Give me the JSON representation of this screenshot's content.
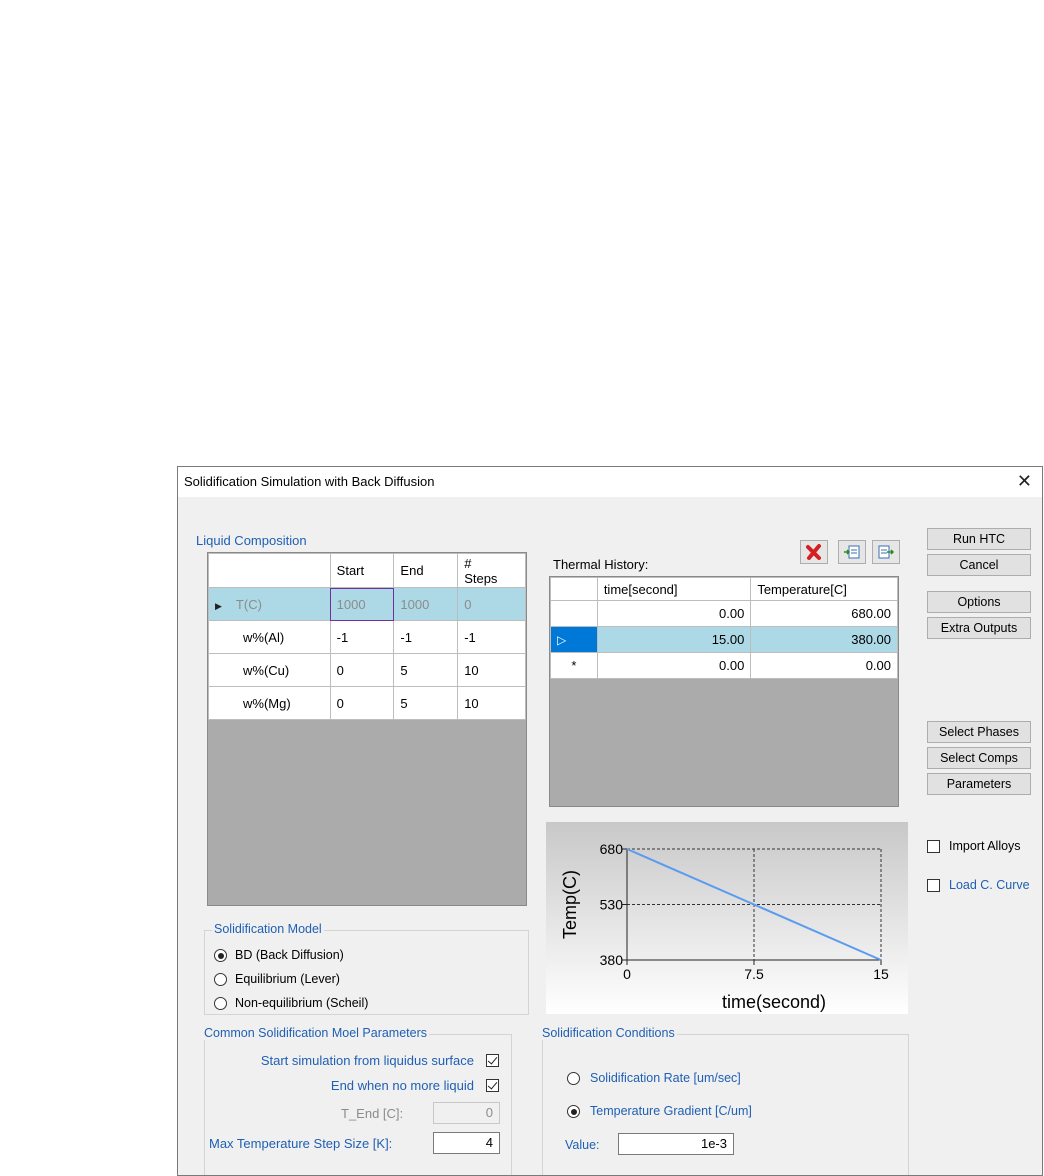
{
  "dialog": {
    "title": "Solidification Simulation with Back Diffusion",
    "close": "✕"
  },
  "liquid": {
    "label": "Liquid Composition",
    "headers": [
      "Start",
      "End",
      "#\nSteps"
    ],
    "rows": [
      {
        "name": "T(C)",
        "start": "1000",
        "end": "1000",
        "steps": "0"
      },
      {
        "name": "w%(Al)",
        "start": "-1",
        "end": "-1",
        "steps": "-1"
      },
      {
        "name": "w%(Cu)",
        "start": "0",
        "end": "5",
        "steps": "10"
      },
      {
        "name": "w%(Mg)",
        "start": "0",
        "end": "5",
        "steps": "10"
      }
    ]
  },
  "thermal": {
    "label": "Thermal History:",
    "headers": [
      "time[second]",
      "Temperature[C]"
    ],
    "rows": [
      {
        "time": "0.00",
        "temp": "680.00"
      },
      {
        "time": "15.00",
        "temp": "380.00"
      },
      {
        "marker": "*",
        "time": "0.00",
        "temp": "0.00"
      }
    ]
  },
  "chart_data": {
    "type": "line",
    "x": [
      0,
      15
    ],
    "series": [
      {
        "values": [
          680,
          380
        ]
      }
    ],
    "xlabel": "time(second)",
    "ylabel": "Temp(C)",
    "xticks": [
      "0",
      "7.5",
      "15"
    ],
    "yticks": [
      "680",
      "530",
      "380"
    ],
    "xlim": [
      0,
      15
    ],
    "ylim": [
      380,
      680
    ],
    "grid": true,
    "line_color": "#5b9bf0"
  },
  "buttons": {
    "run": "Run HTC",
    "cancel": "Cancel",
    "options": "Options",
    "extra": "Extra Outputs",
    "phases": "Select Phases",
    "comps": "Select Comps",
    "params": "Parameters"
  },
  "checks": {
    "import": "Import Alloys",
    "load": "Load C. Curve"
  },
  "model": {
    "label": "Solidification Model",
    "options": [
      "BD (Back Diffusion)",
      "Equilibrium (Lever)",
      "Non-equilibrium (Scheil)"
    ],
    "selected": 0
  },
  "common": {
    "label": "Common Solidification Moel Parameters",
    "start_liq": "Start simulation from liquidus surface",
    "end_liq": "End when no more liquid",
    "tend_label": "T_End [C]:",
    "tend_value": "0",
    "maxstep_label": "Max Temperature Step Size [K]:",
    "maxstep_value": "4"
  },
  "conditions": {
    "label": "Solidification Conditions",
    "rate": "Solidification Rate [um/sec]",
    "gradient": "Temperature Gradient [C/um]",
    "value_label": "Value:",
    "value": "1e-3",
    "selected": 1
  }
}
